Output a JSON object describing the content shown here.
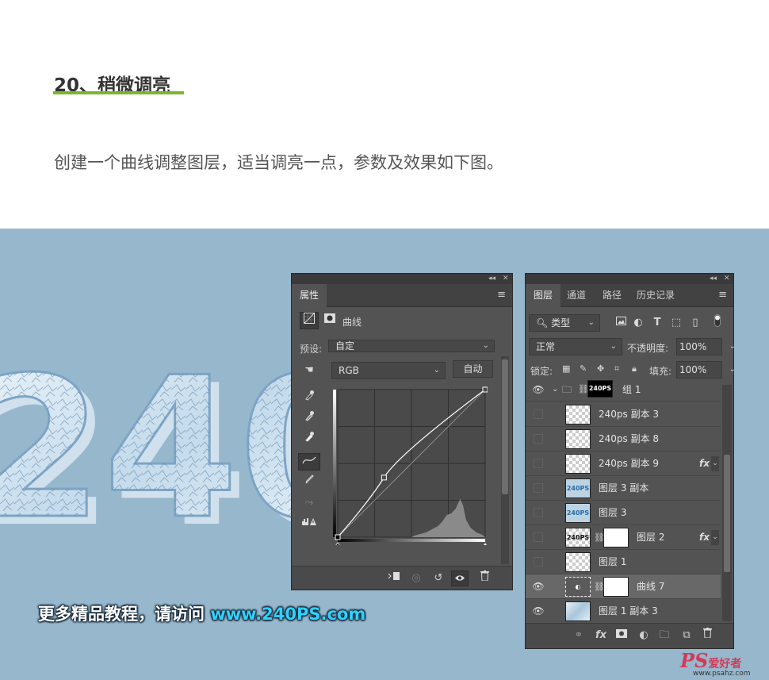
{
  "article": {
    "step_title": "20、稍微调亮",
    "description": "创建一个曲线调整图层，适当调亮一点，参数及效果如下图。",
    "accent_color": "#7ab630"
  },
  "canvas": {
    "background": "#97b7cc",
    "artwork_text": "240",
    "promo_prefix": "更多精品教程，请访问 ",
    "promo_url": "www.240PS.com"
  },
  "properties_panel": {
    "collapse_glyph": "◂◂",
    "close_glyph": "✕",
    "tab": "属性",
    "adjustment_label": "曲线",
    "preset_label": "预设:",
    "preset_value": "自定",
    "channel_value": "RGB",
    "auto_button": "自动",
    "curve": {
      "input_range": [
        0,
        255
      ],
      "points": [
        [
          0,
          0
        ],
        [
          80,
          103
        ],
        [
          255,
          255
        ]
      ]
    },
    "menu_icon": "≡"
  },
  "layers_panel": {
    "tabs": [
      "图层",
      "通道",
      "路径",
      "历史记录"
    ],
    "active_tab": 0,
    "filter_label": "类型",
    "blend_mode": "正常",
    "opacity_label": "不透明度:",
    "opacity_value": "100%",
    "lock_label": "锁定:",
    "fill_label": "填充:",
    "fill_value": "100%",
    "group_name": "组 1",
    "group_thumb_text": "240PS",
    "layers": [
      {
        "name": "240ps 副本 3",
        "visible": false,
        "fx": false
      },
      {
        "name": "240ps 副本 8",
        "visible": false,
        "fx": false
      },
      {
        "name": "240ps 副本 9",
        "visible": false,
        "fx": true
      },
      {
        "name": "图层 3 副本",
        "visible": false,
        "fx": false,
        "thumb_text": "240PS"
      },
      {
        "name": "图层 3",
        "visible": false,
        "fx": false,
        "thumb_text": "240PS"
      },
      {
        "name": "图层 2",
        "visible": false,
        "fx": true,
        "thumb_text": "240PS"
      },
      {
        "name": "图层 1",
        "visible": false,
        "fx": false
      },
      {
        "name": "曲线 7",
        "visible": true,
        "fx": false,
        "selected": true
      },
      {
        "name": "图层 1 副本 3",
        "visible": true,
        "fx": false
      }
    ],
    "fx_label": "fx",
    "menu_icon": "≡"
  },
  "watermark": {
    "logo": "PS",
    "text": "爱好者",
    "domain": "www.psahz.com"
  },
  "icons": {
    "eye": "eye-icon",
    "chain": "link-icon",
    "trash": "trash-icon",
    "folder": "folder-icon"
  }
}
